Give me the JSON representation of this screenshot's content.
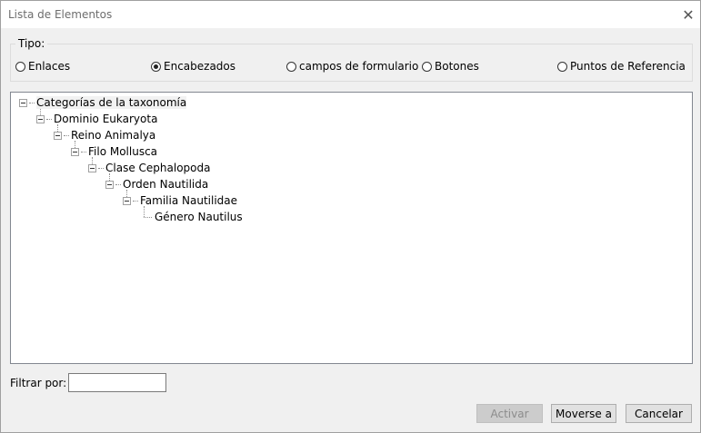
{
  "window": {
    "title": "Lista de Elementos"
  },
  "type_group": {
    "label": "Tipo:",
    "options": [
      {
        "label": "Enlaces",
        "selected": false
      },
      {
        "label": "Encabezados",
        "selected": true
      },
      {
        "label": "campos de formulario",
        "selected": false
      },
      {
        "label": "Botones",
        "selected": false
      },
      {
        "label": "Puntos de Referencia",
        "selected": false
      }
    ]
  },
  "tree": [
    {
      "label": "Categorías de la taxonomía",
      "level": 0,
      "expanded": true
    },
    {
      "label": "Dominio Eukaryota",
      "level": 1,
      "expanded": true
    },
    {
      "label": "Reino Animalya",
      "level": 2,
      "expanded": true
    },
    {
      "label": "Filo Mollusca",
      "level": 3,
      "expanded": true
    },
    {
      "label": "Clase Cephalopoda",
      "level": 4,
      "expanded": true
    },
    {
      "label": "Orden Nautilida",
      "level": 5,
      "expanded": true
    },
    {
      "label": "Familia Nautilidae",
      "level": 6,
      "expanded": true
    },
    {
      "label": "Género Nautilus",
      "level": 7,
      "expanded": false
    }
  ],
  "filter": {
    "label": "Filtrar por:",
    "value": ""
  },
  "buttons": {
    "activate": "Activar",
    "move_to": "Moverse a",
    "cancel": "Cancelar"
  }
}
